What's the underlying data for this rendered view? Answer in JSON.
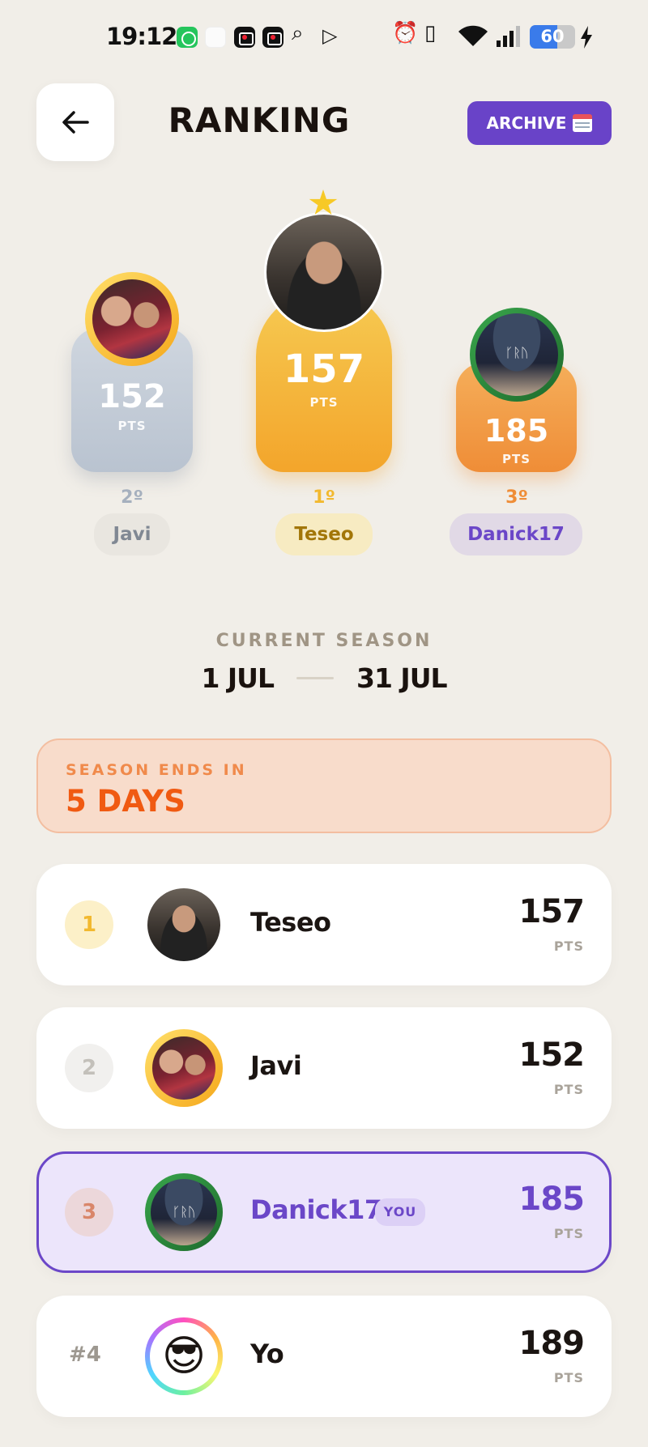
{
  "status_bar": {
    "time": "19:12",
    "battery": "60",
    "battery_level": 0.6
  },
  "header": {
    "title": "RANKING",
    "archive_label": "ARCHIVE"
  },
  "podium": {
    "first": {
      "place": "1º",
      "name": "Teseo",
      "points": "157",
      "unit": "PTS"
    },
    "second": {
      "place": "2º",
      "name": "Javi",
      "points": "152",
      "unit": "PTS"
    },
    "third": {
      "place": "3º",
      "name": "Danick17",
      "points": "185",
      "unit": "PTS"
    }
  },
  "season": {
    "label": "CURRENT SEASON",
    "start": "1 JUL",
    "end": "31 JUL"
  },
  "season_end": {
    "label": "SEASON ENDS IN",
    "value": "5 DAYS"
  },
  "ranking": [
    {
      "rank": "1",
      "name": "Teseo",
      "points": "157",
      "unit": "PTS"
    },
    {
      "rank": "2",
      "name": "Javi",
      "points": "152",
      "unit": "PTS"
    },
    {
      "rank": "3",
      "name": "Danick17",
      "points": "185",
      "unit": "PTS",
      "badge": "YOU"
    },
    {
      "rank": "#4",
      "name": "Yo",
      "points": "189",
      "unit": "PTS"
    }
  ],
  "colors": {
    "accent": "#6943c8",
    "gold": "#f5a81c",
    "orange": "#f05a12"
  },
  "icons": [
    "back-arrow-icon",
    "calendar-icon",
    "star-icon",
    "whatsapp-icon",
    "alarm-icon",
    "vibrate-icon",
    "wifi-icon",
    "signal-icon",
    "battery-icon",
    "charging-icon"
  ]
}
